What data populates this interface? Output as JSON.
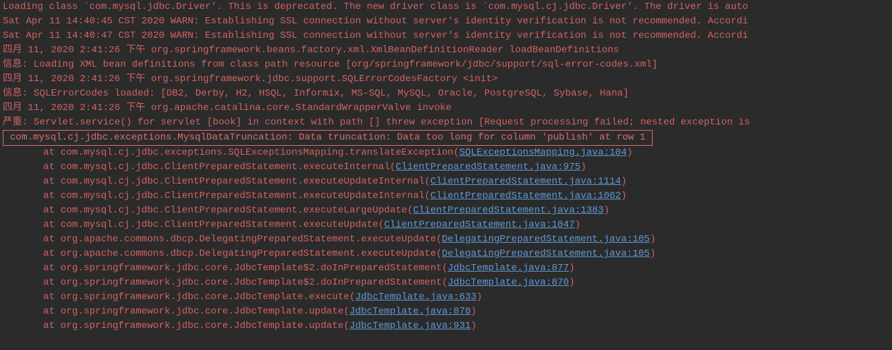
{
  "lines": [
    {
      "t": "Loading class `com.mysql.jdbc.Driver'. This is deprecated. The new driver class is `com.mysql.cj.jdbc.Driver'. The driver is auto",
      "c": "red"
    },
    {
      "t": "Sat Apr 11 14:40:45 CST 2020 WARN: Establishing SSL connection without server's identity verification is not recommended. Accordi",
      "c": "red"
    },
    {
      "t": "Sat Apr 11 14:40:47 CST 2020 WARN: Establishing SSL connection without server's identity verification is not recommended. Accordi",
      "c": "red"
    },
    {
      "t": "四月 11, 2020 2:41:26 下午 org.springframework.beans.factory.xml.XmlBeanDefinitionReader loadBeanDefinitions",
      "c": "red"
    },
    {
      "t": "信息: Loading XML bean definitions from class path resource [org/springframework/jdbc/support/sql-error-codes.xml]",
      "c": "red"
    },
    {
      "t": "四月 11, 2020 2:41:26 下午 org.springframework.jdbc.support.SQLErrorCodesFactory <init>",
      "c": "red"
    },
    {
      "t": "信息: SQLErrorCodes loaded: [DB2, Derby, H2, HSQL, Informix, MS-SQL, MySQL, Oracle, PostgreSQL, Sybase, Hana]",
      "c": "red"
    },
    {
      "t": "四月 11, 2020 2:41:26 下午 org.apache.catalina.core.StandardWrapperValve invoke",
      "c": "red"
    },
    {
      "t": "严重: Servlet.service() for servlet [book] in context with path [] threw exception [Request processing failed; nested exception is",
      "c": "red"
    }
  ],
  "highlighted_line": " com.mysql.cj.jdbc.exceptions.MysqlDataTruncation: Data truncation: Data too long for column 'publish' at row 1 ",
  "stack": [
    {
      "pre": "at com.mysql.cj.jdbc.exceptions.SQLExceptionsMapping.translateException(",
      "link": "SQLExceptionsMapping.java:104",
      "post": ")"
    },
    {
      "pre": "at com.mysql.cj.jdbc.ClientPreparedStatement.executeInternal(",
      "link": "ClientPreparedStatement.java:975",
      "post": ")"
    },
    {
      "pre": "at com.mysql.cj.jdbc.ClientPreparedStatement.executeUpdateInternal(",
      "link": "ClientPreparedStatement.java:1114",
      "post": ")"
    },
    {
      "pre": "at com.mysql.cj.jdbc.ClientPreparedStatement.executeUpdateInternal(",
      "link": "ClientPreparedStatement.java:1062",
      "post": ")"
    },
    {
      "pre": "at com.mysql.cj.jdbc.ClientPreparedStatement.executeLargeUpdate(",
      "link": "ClientPreparedStatement.java:1383",
      "post": ")"
    },
    {
      "pre": "at com.mysql.cj.jdbc.ClientPreparedStatement.executeUpdate(",
      "link": "ClientPreparedStatement.java:1047",
      "post": ")"
    },
    {
      "pre": "at org.apache.commons.dbcp.DelegatingPreparedStatement.executeUpdate(",
      "link": "DelegatingPreparedStatement.java:105",
      "post": ")"
    },
    {
      "pre": "at org.apache.commons.dbcp.DelegatingPreparedStatement.executeUpdate(",
      "link": "DelegatingPreparedStatement.java:105",
      "post": ")"
    },
    {
      "pre": "at org.springframework.jdbc.core.JdbcTemplate$2.doInPreparedStatement(",
      "link": "JdbcTemplate.java:877",
      "post": ")"
    },
    {
      "pre": "at org.springframework.jdbc.core.JdbcTemplate$2.doInPreparedStatement(",
      "link": "JdbcTemplate.java:870",
      "post": ")"
    },
    {
      "pre": "at org.springframework.jdbc.core.JdbcTemplate.execute(",
      "link": "JdbcTemplate.java:633",
      "post": ")"
    },
    {
      "pre": "at org.springframework.jdbc.core.JdbcTemplate.update(",
      "link": "JdbcTemplate.java:870",
      "post": ")"
    },
    {
      "pre": "at org.springframework.jdbc.core.JdbcTemplate.update(",
      "link": "JdbcTemplate.java:931",
      "post": ")"
    }
  ]
}
